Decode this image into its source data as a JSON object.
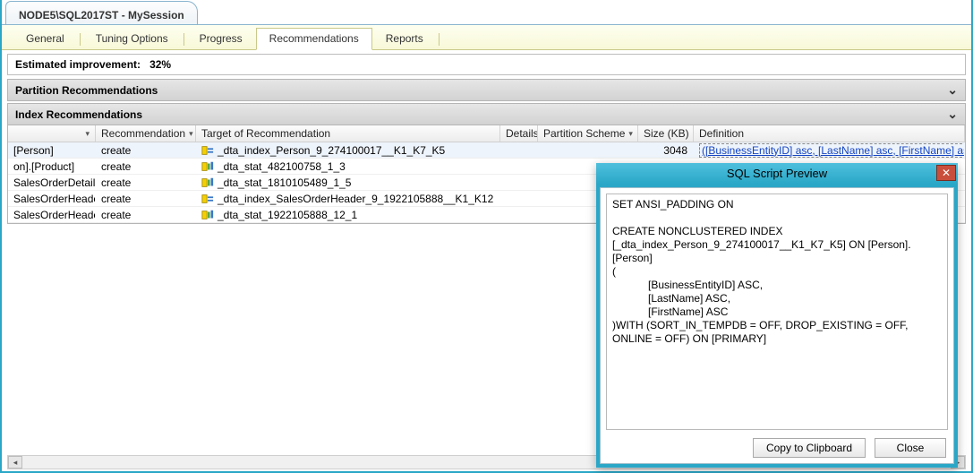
{
  "session_tab": "NODE5\\SQL2017ST - MySession",
  "tabs": [
    "General",
    "Tuning Options",
    "Progress",
    "Recommendations",
    "Reports"
  ],
  "active_tab_index": 3,
  "summary_label": "Estimated improvement:",
  "summary_value": "32%",
  "sections": {
    "partition": "Partition Recommendations",
    "index": "Index Recommendations"
  },
  "columns": [
    "",
    "Recommendation",
    "Target of Recommendation",
    "Details",
    "Partition Scheme",
    "Size (KB)",
    "Definition"
  ],
  "rows": [
    {
      "obj": "[Person]",
      "rec": "create",
      "target": "_dta_index_Person_9_274100017__K1_K7_K5",
      "size": "3048",
      "def": "([BusinessEntityID] asc, [LastName] asc, [FirstName] asc)",
      "def_link": true,
      "icon": "index"
    },
    {
      "obj": "on].[Product]",
      "rec": "create",
      "target": "_dta_stat_482100758_1_3",
      "size": "",
      "def": "",
      "icon": "stat"
    },
    {
      "obj": "SalesOrderDetail]",
      "rec": "create",
      "target": "_dta_stat_1810105489_1_5",
      "size": "",
      "def": "",
      "icon": "stat"
    },
    {
      "obj": "SalesOrderHeader]",
      "rec": "create",
      "target": "_dta_index_SalesOrderHeader_9_1922105888__K1_K12",
      "size": "",
      "def": "",
      "icon": "index"
    },
    {
      "obj": "SalesOrderHeader]",
      "rec": "create",
      "target": "_dta_stat_1922105888_12_1",
      "size": "",
      "def": "",
      "icon": "stat"
    }
  ],
  "preview": {
    "title": "SQL Script Preview",
    "sql": "SET ANSI_PADDING ON\n\nCREATE NONCLUSTERED INDEX\n[_dta_index_Person_9_274100017__K1_K7_K5] ON [Person].[Person]\n(\n            [BusinessEntityID] ASC,\n            [LastName] ASC,\n            [FirstName] ASC\n)WITH (SORT_IN_TEMPDB = OFF, DROP_EXISTING = OFF, ONLINE = OFF) ON [PRIMARY]",
    "copy_label": "Copy to Clipboard",
    "close_label": "Close"
  }
}
